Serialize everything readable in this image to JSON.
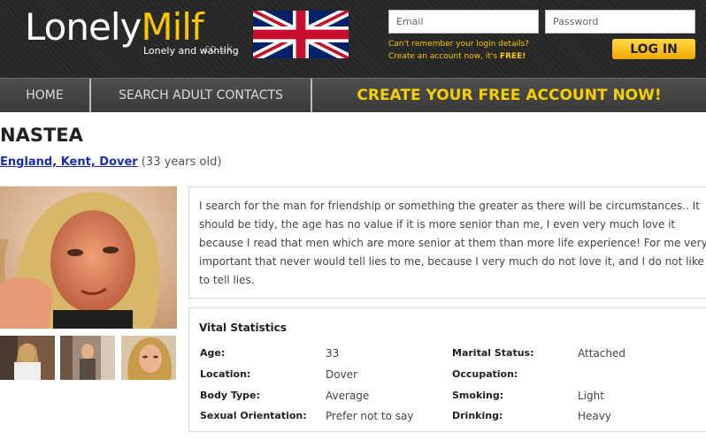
{
  "header": {
    "logo_part1": "Lonely",
    "logo_part2": "Milf",
    "logo_tld": ".co.uk",
    "tagline": "Lonely and wanting",
    "email_placeholder": "Email",
    "password_placeholder": "Password",
    "forgot_text": "Can't remember your login details?",
    "create_text": "Create an account now, it's ",
    "create_free": "FREE!",
    "login_label": "LOG IN"
  },
  "nav": {
    "home": "HOME",
    "search": "SEARCH ADULT CONTACTS",
    "cta": "CREATE YOUR FREE ACCOUNT NOW!"
  },
  "profile": {
    "name": "NASTEA",
    "location_link": "England, Kent, Dover",
    "age_text": "(33 years old)",
    "bio": "I search for the man for friendship or something the greater as there will be circumstances.. It should be tidy, the age has no value if it is more senior than me, I even very much love it because I read that men which are more senior at them than more life experience! For me very important that never would tell lies to me, because I very much do not love it, and I do not like to tell lies."
  },
  "stats": {
    "title": "Vital Statistics",
    "age_label": "Age:",
    "age_value": "33",
    "location_label": "Location:",
    "location_value": "Dover",
    "body_label": "Body Type:",
    "body_value": "Average",
    "orientation_label": "Sexual Orientation:",
    "orientation_value": "Prefer not to say",
    "marital_label": "Marital Status:",
    "marital_value": "Attached",
    "occupation_label": "Occupation:",
    "occupation_value": "",
    "smoking_label": "Smoking:",
    "smoking_value": "Light",
    "drinking_label": "Drinking:",
    "drinking_value": "Heavy"
  },
  "colors": {
    "header_bg": "#262626",
    "accent_yellow": "#f7c600",
    "link_blue": "#1a2cb0",
    "nav_bg": "#444444"
  },
  "icons": {
    "flag": "union-jack-flag"
  }
}
